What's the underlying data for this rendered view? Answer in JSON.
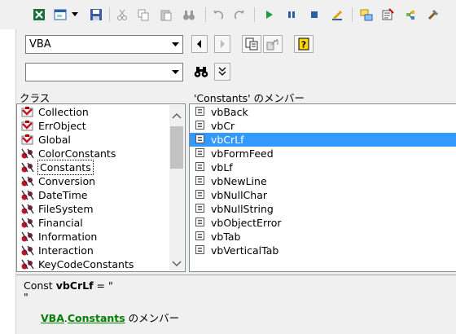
{
  "toolbar": {
    "buttons": [
      {
        "name": "view-excel-button",
        "icon": "excel-icon"
      },
      {
        "name": "insert-userform-button",
        "icon": "userform-icon"
      },
      {
        "name": "save-button",
        "icon": "save-icon"
      },
      {
        "name": "cut-button",
        "icon": "cut-icon"
      },
      {
        "name": "copy-button",
        "icon": "copy-icon"
      },
      {
        "name": "paste-button",
        "icon": "paste-icon"
      },
      {
        "name": "find-button",
        "icon": "binoculars-icon"
      },
      {
        "name": "undo-button",
        "icon": "undo-icon"
      },
      {
        "name": "redo-button",
        "icon": "redo-icon"
      },
      {
        "name": "run-button",
        "icon": "play-icon"
      },
      {
        "name": "break-button",
        "icon": "pause-icon"
      },
      {
        "name": "reset-button",
        "icon": "stop-icon"
      },
      {
        "name": "design-mode-button",
        "icon": "design-icon"
      },
      {
        "name": "project-explorer-button",
        "icon": "project-icon"
      },
      {
        "name": "properties-button",
        "icon": "properties-icon"
      },
      {
        "name": "object-browser-button",
        "icon": "object-browser-icon"
      },
      {
        "name": "toolbox-button",
        "icon": "toolbox-icon"
      }
    ]
  },
  "library_combo": {
    "value": "VBA"
  },
  "search_combo": {
    "value": ""
  },
  "classes": {
    "title": "クラス",
    "items": [
      {
        "label": "Collection",
        "icon": "class-icon"
      },
      {
        "label": "ErrObject",
        "icon": "class-icon"
      },
      {
        "label": "Global",
        "icon": "class-icon"
      },
      {
        "label": "ColorConstants",
        "icon": "module-icon"
      },
      {
        "label": "Constants",
        "icon": "module-icon",
        "focused": true
      },
      {
        "label": "Conversion",
        "icon": "module-icon"
      },
      {
        "label": "DateTime",
        "icon": "module-icon"
      },
      {
        "label": "FileSystem",
        "icon": "module-icon"
      },
      {
        "label": "Financial",
        "icon": "module-icon"
      },
      {
        "label": "Information",
        "icon": "module-icon"
      },
      {
        "label": "Interaction",
        "icon": "module-icon"
      },
      {
        "label": "KeyCodeConstants",
        "icon": "module-icon"
      }
    ]
  },
  "members": {
    "title": "'Constants' のメンバー",
    "items": [
      {
        "label": "vbBack"
      },
      {
        "label": "vbCr"
      },
      {
        "label": "vbCrLf",
        "selected": true
      },
      {
        "label": "vbFormFeed"
      },
      {
        "label": "vbLf"
      },
      {
        "label": "vbNewLine"
      },
      {
        "label": "vbNullChar"
      },
      {
        "label": "vbNullString"
      },
      {
        "label": "vbObjectError"
      },
      {
        "label": "vbTab"
      },
      {
        "label": "vbVerticalTab"
      }
    ]
  },
  "details": {
    "line1_prefix": "Const ",
    "line1_name": "vbCrLf",
    "line1_suffix": " = \"",
    "line2": "\"",
    "link_library": "VBA",
    "link_dot": ".",
    "link_class": "Constants",
    "member_of": " のメンバー"
  },
  "colors": {
    "selection": "#3399ff",
    "link": "#008000"
  }
}
